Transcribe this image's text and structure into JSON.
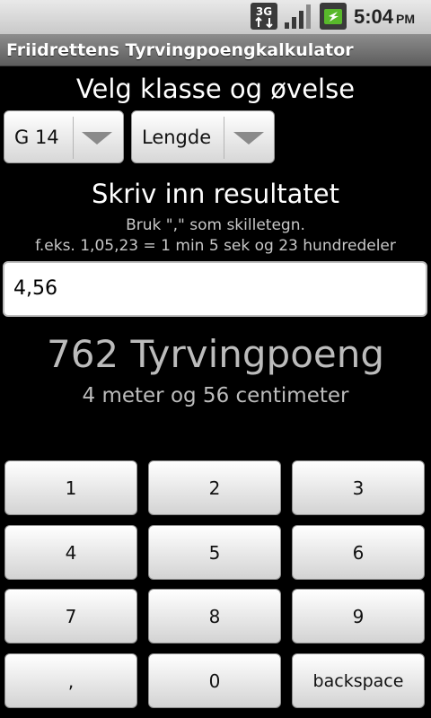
{
  "status_bar": {
    "network": "3G",
    "time": "5:04",
    "ampm": "PM",
    "icons": [
      "3g-data-icon",
      "signal-icon",
      "battery-charging-icon"
    ]
  },
  "app": {
    "title": "Friidrettens Tyrvingpoengkalkulator"
  },
  "selection": {
    "heading": "Velg klasse og øvelse",
    "class_value": "G 14",
    "event_value": "Lengde"
  },
  "result": {
    "heading": "Skriv inn resultatet",
    "hint_line1": "Bruk \",\" som skilletegn.",
    "hint_line2": "f.eks. 1,05,23 = 1 min 5 sek og 23 hundredeler",
    "input_value": "4,56"
  },
  "output": {
    "points_text": "762 Tyrvingpoeng",
    "description": "4 meter og 56 centimeter"
  },
  "keypad": {
    "keys": [
      "1",
      "2",
      "3",
      "4",
      "5",
      "6",
      "7",
      "8",
      "9",
      ",",
      "0",
      "backspace"
    ]
  },
  "colors": {
    "background": "#000000",
    "titlebar": "#6f6f6f",
    "result_text": "#bcbcbc",
    "battery_green": "#58b82b"
  }
}
